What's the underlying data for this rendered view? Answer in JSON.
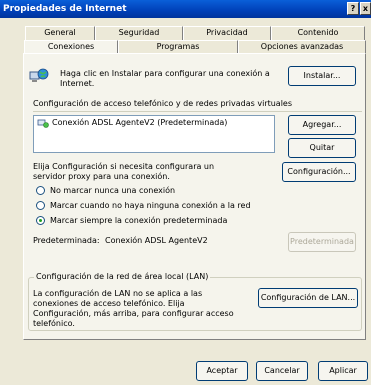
{
  "window": {
    "title": "Propiedades de Internet",
    "help_button": "?",
    "close_button": "x"
  },
  "tabs_back": [
    "General",
    "Seguridad",
    "Privacidad",
    "Contenido"
  ],
  "tabs_front": [
    "Conexiones",
    "Programas",
    "Opciones avanzadas"
  ],
  "active_tab": "Conexiones",
  "setup": {
    "text": "Haga clic en Instalar para configurar una conexión a Internet.",
    "button": "Instalar..."
  },
  "dialup": {
    "group_label": "Configuración de acceso telefónico y de redes privadas virtuales",
    "connections": [
      "Conexión ADSL AgenteV2 (Predeterminada)"
    ],
    "add_button": "Agregar...",
    "remove_button": "Quitar",
    "settings_button": "Configuración...",
    "proxy_text": "Elija Configuración si necesita configurara un servidor proxy para una conexión.",
    "options": [
      {
        "label": "No marcar nunca una conexión",
        "checked": false
      },
      {
        "label": "Marcar cuando no haya ninguna conexión a la red",
        "checked": false
      },
      {
        "label": "Marcar siempre la conexión predeterminada",
        "checked": true
      }
    ],
    "default_label": "Predeterminada:",
    "default_value": "Conexión ADSL AgenteV2",
    "set_default_button": "Predeterminada"
  },
  "lan": {
    "group_label": "Configuración de la red de área local (LAN)",
    "text": "La configuración de LAN no se aplica a las conexiones de acceso telefónico. Elija Configuración, más arriba, para configurar acceso telefónico.",
    "button": "Configuración de LAN..."
  },
  "footer": {
    "ok": "Aceptar",
    "cancel": "Cancelar",
    "apply": "Aplicar"
  },
  "colors": {
    "title_blue": "#0040b8",
    "panel_bg": "#f5f4ec",
    "radio_dot": "#21a121"
  },
  "icons": {
    "setup": "network-globe-icon",
    "connection": "dialup-connection-icon"
  }
}
